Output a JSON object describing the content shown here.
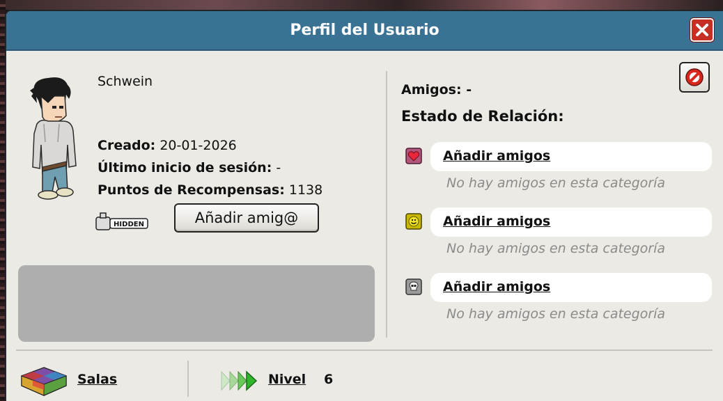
{
  "window": {
    "title": "Perfil del Usuario"
  },
  "profile": {
    "username": "Schwein",
    "created_label": "Creado:",
    "created_value": "20-01-2026",
    "last_login_label": "Último inicio de sesión:",
    "last_login_value": "-",
    "rewards_label": "Puntos de Recompensas:",
    "rewards_value": "1138",
    "hidden_badge": "HIDDEN",
    "add_friend_button": "Añadir amig@"
  },
  "friends": {
    "count_label": "Amigos:",
    "count_value": "-",
    "relationship_heading": "Estado de Relación:",
    "categories": [
      {
        "icon": "heart-icon",
        "link": "Añadir amigos",
        "empty": "No hay amigos en esta categoría"
      },
      {
        "icon": "smiley-icon",
        "link": "Añadir amigos",
        "empty": "No hay amigos en esta categoría"
      },
      {
        "icon": "skull-icon",
        "link": "Añadir amigos",
        "empty": "No hay amigos en esta categoría"
      }
    ]
  },
  "footer": {
    "rooms_label": "Salas",
    "level_label": "Nivel",
    "level_value": "6"
  },
  "colors": {
    "titlebar": "#3a7294",
    "close": "#c72e24",
    "panel": "#eceae4",
    "motto_box": "#aeaeae"
  }
}
